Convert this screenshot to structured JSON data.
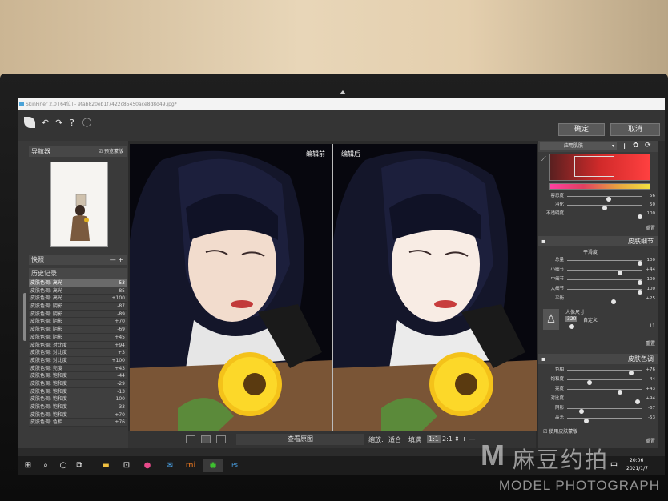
{
  "window": {
    "title": "SkinFiner 2.0 [64位] - 9fab820eb1f7422c85450ace8d8d49.jpg*"
  },
  "toolbar": {
    "icons": [
      "leaf-logo-icon",
      "undo-icon",
      "redo-icon",
      "help-icon",
      "info-icon"
    ],
    "confirm_label": "确定",
    "cancel_label": "取消"
  },
  "navigator": {
    "title": "导航器",
    "checkbox_label": "预览蒙版"
  },
  "snapshots": {
    "title": "快照"
  },
  "history": {
    "title": "历史记录",
    "rows": [
      {
        "name": "皮肤色调: 高光",
        "value": "-53"
      },
      {
        "name": "皮肤色调: 高光",
        "value": "-85"
      },
      {
        "name": "皮肤色调: 高光",
        "value": "+100"
      },
      {
        "name": "皮肤色调: 阴影",
        "value": "-87"
      },
      {
        "name": "皮肤色调: 阴影",
        "value": "-89"
      },
      {
        "name": "皮肤色调: 阴影",
        "value": "+70"
      },
      {
        "name": "皮肤色调: 阴影",
        "value": "-69"
      },
      {
        "name": "皮肤色调: 阴影",
        "value": "+45"
      },
      {
        "name": "皮肤色调: 对比度",
        "value": "+94"
      },
      {
        "name": "皮肤色调: 对比度",
        "value": "+3"
      },
      {
        "name": "皮肤色调: 对比度",
        "value": "+100"
      },
      {
        "name": "皮肤色调: 亮度",
        "value": "+43"
      },
      {
        "name": "皮肤色调: 饱和度",
        "value": "-44"
      },
      {
        "name": "皮肤色调: 饱和度",
        "value": "-29"
      },
      {
        "name": "皮肤色调: 饱和度",
        "value": "-13"
      },
      {
        "name": "皮肤色调: 饱和度",
        "value": "-100"
      },
      {
        "name": "皮肤色调: 饱和度",
        "value": "-33"
      },
      {
        "name": "皮肤色调: 饱和度",
        "value": "+70"
      },
      {
        "name": "皮肤色调: 色相",
        "value": "+76"
      }
    ]
  },
  "viewer": {
    "before_label": "编辑前",
    "after_label": "编辑后",
    "view_original_label": "查看原图",
    "zoom_label": "缩放:",
    "fit_label": "适合",
    "fill_label": "填满",
    "ratio_11": "1:1",
    "ratio_21": "2:1"
  },
  "skin_area": {
    "preset_label": "应用肌肤",
    "sliders": [
      {
        "label": "容忍度",
        "value": "56",
        "pct": 0.56
      },
      {
        "label": "羽化",
        "value": "50",
        "pct": 0.5
      },
      {
        "label": "不透明度",
        "value": "100",
        "pct": 1.0
      }
    ],
    "reset_label": "重置"
  },
  "skin_detail": {
    "title": "皮肤细节",
    "subtitle": "平滑度",
    "sliders": [
      {
        "label": "总量",
        "value": "100",
        "pct": 1.0
      },
      {
        "label": "小细节",
        "value": "+44",
        "pct": 0.72
      },
      {
        "label": "中细节",
        "value": "100",
        "pct": 1.0
      },
      {
        "label": "大细节",
        "value": "100",
        "pct": 1.0
      },
      {
        "label": "平衡",
        "value": "+25",
        "pct": 0.62
      }
    ],
    "portrait_size_label": "人像尺寸",
    "portrait_option": "320",
    "custom_label": "自定义",
    "portrait_value": "11",
    "reset_label": "重置"
  },
  "skin_tone": {
    "title": "皮肤色调",
    "sliders": [
      {
        "label": "色相",
        "value": "+76",
        "pct": 0.88
      },
      {
        "label": "饱和度",
        "value": "-44",
        "pct": 0.28
      },
      {
        "label": "亮度",
        "value": "+43",
        "pct": 0.72
      },
      {
        "label": "对比度",
        "value": "+94",
        "pct": 0.97
      },
      {
        "label": "阴影",
        "value": "-67",
        "pct": 0.17
      },
      {
        "label": "高光",
        "value": "-53",
        "pct": 0.24
      }
    ],
    "mask_label": "使用皮肤蒙版",
    "reset_label": "重置"
  },
  "taskbar": {
    "clock_time": "20:06",
    "clock_date": "2021/1/7",
    "ime_label": "中"
  },
  "watermark": {
    "logo": "M",
    "brand_cn": "麻豆约拍",
    "brand_en": "MODEL PHOTOGRAPH"
  },
  "colors": {
    "panel": "#3a3a3a",
    "accent_red": "#d12a2a",
    "screen_bg": "#2b2b2b"
  }
}
